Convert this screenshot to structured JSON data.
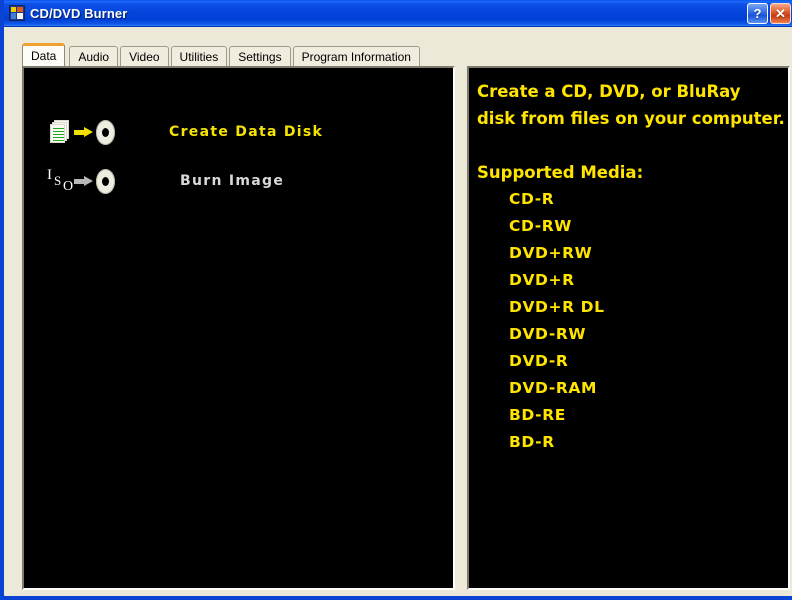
{
  "window": {
    "title": "CD/DVD Burner",
    "icon": "app-squares-icon",
    "help_label": "?",
    "close_label": "✕"
  },
  "tabs": [
    {
      "label": "Data",
      "selected": true
    },
    {
      "label": "Audio",
      "selected": false
    },
    {
      "label": "Video",
      "selected": false
    },
    {
      "label": "Utilities",
      "selected": false
    },
    {
      "label": "Settings",
      "selected": false
    },
    {
      "label": "Program Information",
      "selected": false
    }
  ],
  "left_panel": {
    "actions": [
      {
        "label": "Create Data Disk",
        "icon": "document-to-disc-icon",
        "arrow": "yellow-arrow-icon",
        "color": "#f5e400"
      },
      {
        "label": "Burn Image",
        "icon": "iso-to-disc-icon",
        "arrow": "grey-arrow-icon",
        "color": "#d8d8d8"
      }
    ],
    "iso_glyph": {
      "i": "I",
      "s": "S",
      "o": "O"
    }
  },
  "right_panel": {
    "description_line_1": "Create a CD, DVD, or BluRay",
    "description_line_2": "disk from files on your computer.",
    "supported_heading": "Supported Media:",
    "media": [
      "CD-R",
      "CD-RW",
      "DVD+RW",
      "DVD+R",
      "DVD+R DL",
      "DVD-RW",
      "DVD-R",
      "DVD-RAM",
      "BD-RE",
      "BD-R"
    ]
  },
  "colors": {
    "titlebar_blue": "#0a46e0",
    "dialog_face": "#ece9d8",
    "panel_background": "#000000",
    "accent_yellow": "#ffe400",
    "tab_highlight": "#f0a030",
    "muted_white": "#d8d8d8"
  }
}
